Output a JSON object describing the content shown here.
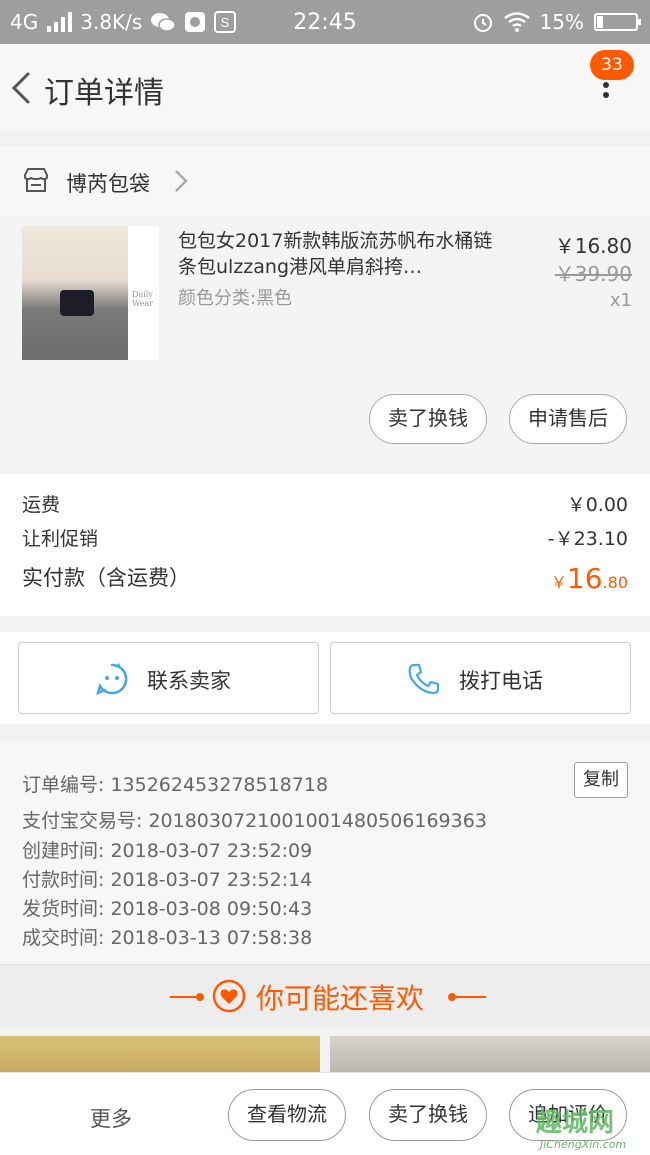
{
  "status_bar": {
    "network": "4G",
    "speed": "3.8K/s",
    "time": "22:45",
    "battery_text": "15%",
    "battery_level": 0.15
  },
  "nav": {
    "title": "订单详情",
    "badge": "33"
  },
  "shop": {
    "name": "博芮包袋"
  },
  "product": {
    "title": "包包女2017新款韩版流苏帆布水桶链条包ulzzang港风单肩斜挎…",
    "variant": "颜色分类:黑色",
    "price": "￥16.80",
    "original_price": "￥39.90",
    "quantity": "x1",
    "thumb_signature": "Daily Wear",
    "buttons": {
      "sell": "卖了换钱",
      "after_sale": "申请售后"
    }
  },
  "summary": {
    "shipping_label": "运费",
    "shipping_value": "￥0.00",
    "discount_label": "让利促销",
    "discount_value": "-￥23.10",
    "total_label": "实付款（含运费）",
    "total_currency": "￥",
    "total_main": "16",
    "total_decimal": ".80"
  },
  "contact": {
    "chat_label": "联系卖家",
    "phone_label": "拨打电话"
  },
  "order_info": {
    "order_no": "订单编号: 135262453278518718",
    "copy_label": "复制",
    "alipay_no": "支付宝交易号: 2018030721001001480506169363",
    "created": "创建时间: 2018-03-07 23:52:09",
    "paid": "付款时间: 2018-03-07 23:52:14",
    "shipped": "发货时间: 2018-03-08 09:50:43",
    "completed": "成交时间: 2018-03-13 07:58:38"
  },
  "recommend": {
    "title": "你可能还喜欢"
  },
  "bottom_bar": {
    "more": "更多",
    "logistics": "查看物流",
    "sell": "卖了换钱",
    "review": "追加评价"
  },
  "watermark": {
    "cn": "趣城网",
    "en": "JiChengXin.com"
  },
  "colors": {
    "accent": "#ff5a00",
    "contact_icon": "#3fa9e8",
    "status_bar": "#9e9e9e"
  }
}
